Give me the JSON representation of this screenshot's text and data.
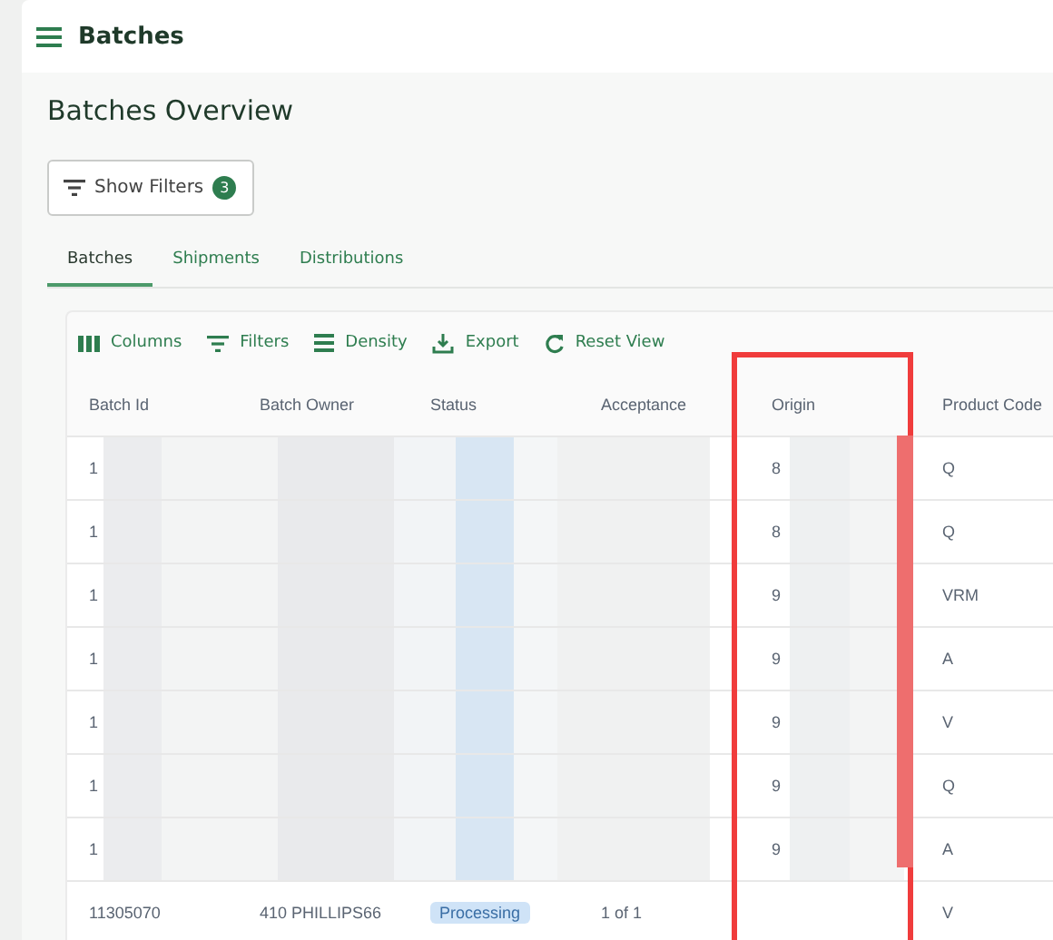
{
  "header": {
    "title": "Batches"
  },
  "page_title": "Batches Overview",
  "filter_button": {
    "label": "Show Filters",
    "count": "3"
  },
  "tabs": [
    {
      "label": "Batches",
      "selected": true
    },
    {
      "label": "Shipments",
      "selected": false
    },
    {
      "label": "Distributions",
      "selected": false
    }
  ],
  "toolbar": [
    {
      "kind": "columns",
      "label": "Columns"
    },
    {
      "kind": "filters",
      "label": "Filters"
    },
    {
      "kind": "density",
      "label": "Density"
    },
    {
      "kind": "export",
      "label": "Export"
    },
    {
      "kind": "reset",
      "label": "Reset View"
    }
  ],
  "table": {
    "columns": [
      {
        "label": "Batch Id",
        "highlighted": false
      },
      {
        "label": "Batch Owner",
        "highlighted": false
      },
      {
        "label": "Status",
        "highlighted": false
      },
      {
        "label": "Acceptance",
        "highlighted": false
      },
      {
        "label": "Origin",
        "highlighted": true
      },
      {
        "label": "Product Code",
        "highlighted": false
      }
    ],
    "rows": [
      {
        "batch_id": "1",
        "origin": "8",
        "product_code": "Q",
        "redacted": true
      },
      {
        "batch_id": "1",
        "origin": "8",
        "product_code": "Q",
        "redacted": true
      },
      {
        "batch_id": "1",
        "origin": "9",
        "product_code": "VRM",
        "redacted": true
      },
      {
        "batch_id": "1",
        "origin": "9",
        "product_code": "A",
        "redacted": true
      },
      {
        "batch_id": "1",
        "origin": "9",
        "product_code": "V",
        "redacted": true
      },
      {
        "batch_id": "1",
        "origin": "9",
        "product_code": "Q",
        "redacted": true
      },
      {
        "batch_id": "1",
        "origin": "9",
        "product_code": "A",
        "redacted": true
      },
      {
        "batch_id": "11305070",
        "batch_owner": "410 PHILLIPS66",
        "status": "Processing",
        "acceptance": "1 of 1",
        "product_code": "V",
        "redacted": false
      }
    ]
  }
}
